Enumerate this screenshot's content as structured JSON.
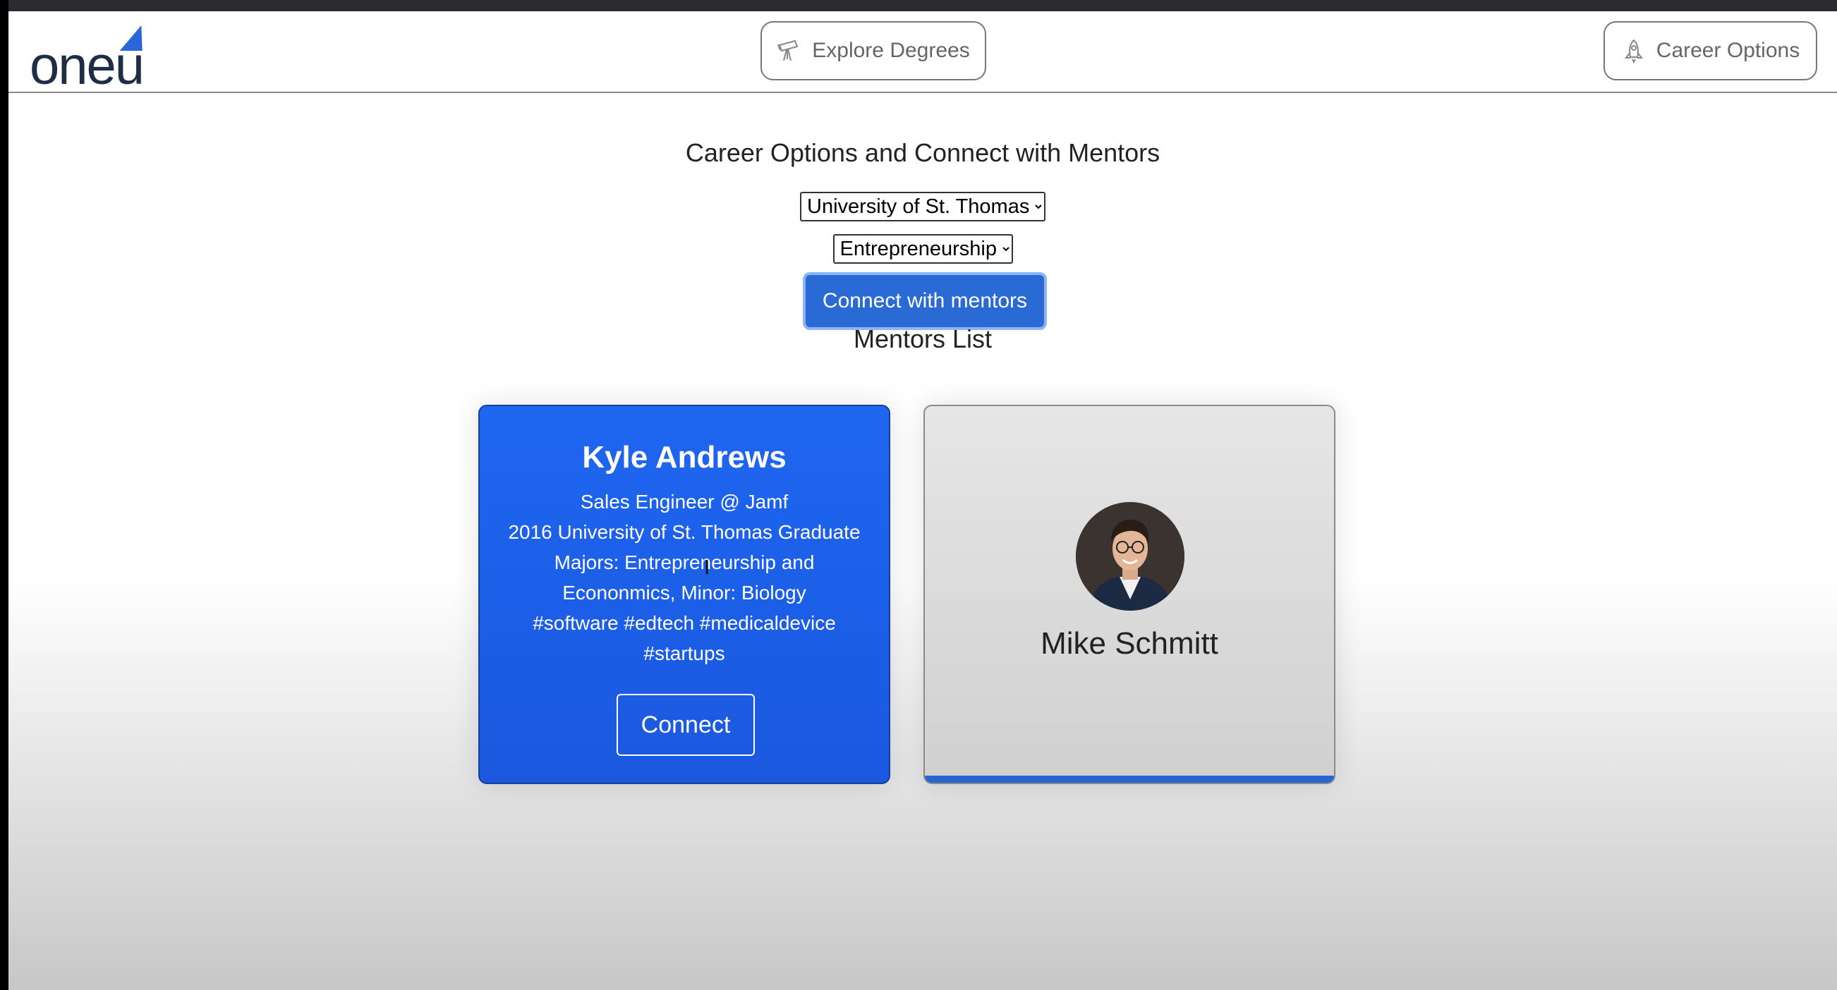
{
  "logo": {
    "text": "oneu"
  },
  "nav": {
    "explore_label": "Explore Degrees",
    "explore_icon": "telescope-icon",
    "career_label": "Career Options",
    "career_icon": "rocket-icon"
  },
  "page": {
    "title": "Career Options and Connect with Mentors",
    "university_select": {
      "selected": "University of St. Thomas"
    },
    "major_select": {
      "selected": "Entrepreneurship"
    },
    "connect_button": "Connect with mentors",
    "list_title": "Mentors List"
  },
  "mentors": [
    {
      "name": "Kyle Andrews",
      "lines": [
        "Sales Engineer @ Jamf",
        "2016 University of St. Thomas Graduate",
        "Majors: Entrepreneurship and",
        "Econonmics, Minor: Biology",
        "#software #edtech #medicaldevice",
        "#startups"
      ],
      "button": "Connect"
    },
    {
      "name": "Mike Schmitt"
    }
  ],
  "colors": {
    "accent": "#2a6ad4",
    "card_active": "#1e66f0",
    "logo_text": "#1f2e46"
  }
}
